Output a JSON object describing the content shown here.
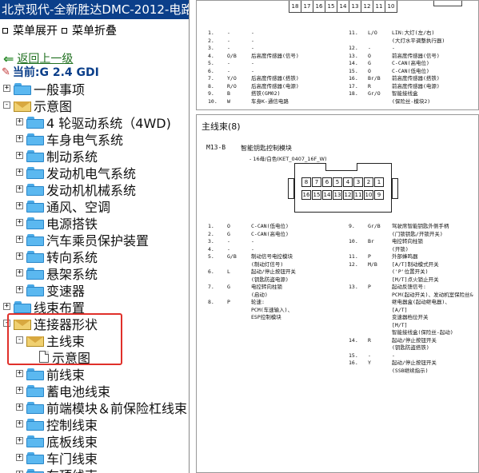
{
  "left_pane": {
    "title": "北京现代-全新胜达DMC-2012-电路图",
    "menu": {
      "expand": "菜单展开",
      "collapse": "菜单折叠"
    },
    "back": "返回上一级",
    "current": "当前:G 2.4 GDI",
    "tree": [
      {
        "label": "一般事项",
        "pm": "+",
        "icon": "folder"
      },
      {
        "label": "示意图",
        "pm": "-",
        "icon": "envelope"
      },
      {
        "label": "4 轮驱动系统（4WD)",
        "pm": "+",
        "icon": "folder"
      },
      {
        "label": "车身电气系统",
        "pm": "+",
        "icon": "folder"
      },
      {
        "label": "制动系统",
        "pm": "+",
        "icon": "folder"
      },
      {
        "label": "发动机电气系统",
        "pm": "+",
        "icon": "folder"
      },
      {
        "label": "发动机机械系统",
        "pm": "+",
        "icon": "folder"
      },
      {
        "label": "通风、空调",
        "pm": "+",
        "icon": "folder"
      },
      {
        "label": "电源搭铁",
        "pm": "+",
        "icon": "folder"
      },
      {
        "label": "汽车乘员保护装置",
        "pm": "+",
        "icon": "folder"
      },
      {
        "label": "转向系统",
        "pm": "+",
        "icon": "folder"
      },
      {
        "label": "悬架系统",
        "pm": "+",
        "icon": "folder"
      },
      {
        "label": "变速器",
        "pm": "+",
        "icon": "folder"
      },
      {
        "label": "线束布置",
        "pm": "+",
        "icon": "folder"
      },
      {
        "label": "连接器形状",
        "pm": "-",
        "icon": "envelope"
      },
      {
        "label": "主线束",
        "pm": "-",
        "icon": "envelope"
      },
      {
        "label": "示意图",
        "pm": "",
        "icon": "page"
      },
      {
        "label": "前线束",
        "pm": "+",
        "icon": "folder"
      },
      {
        "label": "蓄电池线束",
        "pm": "+",
        "icon": "folder"
      },
      {
        "label": "前端模块＆前保险杠线束",
        "pm": "+",
        "icon": "folder"
      },
      {
        "label": "控制线束",
        "pm": "+",
        "icon": "folder"
      },
      {
        "label": "底板线束",
        "pm": "+",
        "icon": "folder"
      },
      {
        "label": "车门线束",
        "pm": "+",
        "icon": "folder"
      },
      {
        "label": "车顶线束",
        "pm": "+",
        "icon": "folder"
      }
    ]
  },
  "top_panel": {
    "pin_strip": [
      "18",
      "17",
      "16",
      "15",
      "14",
      "13",
      "12",
      "11",
      "10"
    ],
    "left_pins": [
      {
        "n": "1.",
        "c": "-",
        "d": "-"
      },
      {
        "n": "2.",
        "c": "-",
        "d": "-"
      },
      {
        "n": "3.",
        "c": "-",
        "d": "-"
      },
      {
        "n": "4.",
        "c": "O/B",
        "d": "后高度传感器(信号)"
      },
      {
        "n": "5.",
        "c": "-",
        "d": "-"
      },
      {
        "n": "6.",
        "c": "-",
        "d": "-"
      },
      {
        "n": "7.",
        "c": "Y/O",
        "d": "后高度传感器(搭铁)"
      },
      {
        "n": "8.",
        "c": "R/O",
        "d": "后高度传感器(电源)"
      },
      {
        "n": "9.",
        "c": "B",
        "d": "搭铁(GM02)"
      },
      {
        "n": "10.",
        "c": "W",
        "d": "车身K-通信电路"
      }
    ],
    "right_pins": [
      {
        "n": "11.",
        "c": "L/O",
        "d": "LIN:大灯(左/右)"
      },
      {
        "n": "",
        "c": "",
        "d": "(大灯水平调整执行器)"
      },
      {
        "n": "12.",
        "c": "-",
        "d": "-"
      },
      {
        "n": "13.",
        "c": "O",
        "d": "前高度传感器(信号)"
      },
      {
        "n": "14.",
        "c": "G",
        "d": "C-CAN(高电位)"
      },
      {
        "n": "15.",
        "c": "O",
        "d": "C-CAN(低电位)"
      },
      {
        "n": "16.",
        "c": "Br/B",
        "d": "前高度传感器(搭铁)"
      },
      {
        "n": "17.",
        "c": "R",
        "d": "前高度传感器(电源)"
      },
      {
        "n": "18.",
        "c": "Gr/O",
        "d": "智能接线盒"
      },
      {
        "n": "",
        "c": "",
        "d": "(保险丝-模块2)"
      }
    ]
  },
  "bottom_panel": {
    "title": "主线束(8)",
    "conn_id": "M13-B",
    "conn_name": "智能钥匙控制模块",
    "conn_sub": "- 16母/白色(KET_0407_16F_W)",
    "row_top": [
      "8",
      "7",
      "6",
      "5",
      "4",
      "3",
      "2",
      "1"
    ],
    "row_bottom": [
      "16",
      "15",
      "14",
      "13",
      "12",
      "11",
      "10",
      "9"
    ],
    "left_pins": [
      {
        "n": "1.",
        "c": "O",
        "d": "C-CAN(低电位)"
      },
      {
        "n": "2.",
        "c": "G",
        "d": "C-CAN(高电位)"
      },
      {
        "n": "3.",
        "c": "-",
        "d": "-"
      },
      {
        "n": "4.",
        "c": "-",
        "d": "-"
      },
      {
        "n": "5.",
        "c": "G/B",
        "d": "制动信号电控模块"
      },
      {
        "n": "",
        "c": "",
        "d": "(制动灯信号)"
      },
      {
        "n": "6.",
        "c": "L",
        "d": "起动/停止按钮开关"
      },
      {
        "n": "",
        "c": "",
        "d": "(钥匙防盗电源)"
      },
      {
        "n": "7.",
        "c": "G",
        "d": "电控转向柱锁"
      },
      {
        "n": "",
        "c": "",
        "d": "(启动)"
      },
      {
        "n": "8.",
        "c": "P",
        "d": "轮速:"
      },
      {
        "n": "",
        "c": "",
        "d": "PCM(车速输入)、"
      },
      {
        "n": "",
        "c": "",
        "d": "ESP控制模块"
      }
    ],
    "right_pins": [
      {
        "n": "9.",
        "c": "Gr/B",
        "d": "驾驶席智能钥匙外侧手柄"
      },
      {
        "n": "",
        "c": "",
        "d": "(门锁钥匙/开锁开关)"
      },
      {
        "n": "10.",
        "c": "Br",
        "d": "电控转向柱锁"
      },
      {
        "n": "",
        "c": "",
        "d": "(开锁)"
      },
      {
        "n": "11.",
        "c": "P",
        "d": "外部蜂鸣器"
      },
      {
        "n": "12.",
        "c": "M/B",
        "d": "[A/T]制动模式开关"
      },
      {
        "n": "",
        "c": "",
        "d": "('P'位置开关)"
      },
      {
        "n": "",
        "c": "",
        "d": "[M/T]点火锁止开关"
      },
      {
        "n": "13.",
        "c": "P",
        "d": "起动反馈信号:"
      },
      {
        "n": "",
        "c": "",
        "d": "PCM(起动开关)、发动机室保险丝&"
      },
      {
        "n": "",
        "c": "",
        "d": "继电器盒(起动继电器)、"
      },
      {
        "n": "",
        "c": "",
        "d": "[A/T]"
      },
      {
        "n": "",
        "c": "",
        "d": "变速器档位开关"
      },
      {
        "n": "",
        "c": "",
        "d": "[M/T]"
      },
      {
        "n": "",
        "c": "",
        "d": "智能接线盒(保险丝-起动)"
      },
      {
        "n": "14.",
        "c": "R",
        "d": "起动/停止按钮开关"
      },
      {
        "n": "",
        "c": "",
        "d": "(钥匙防盗搭铁)"
      },
      {
        "n": "15.",
        "c": "-",
        "d": "-"
      },
      {
        "n": "16.",
        "c": "Y",
        "d": "起动/停止按钮开关"
      },
      {
        "n": "",
        "c": "",
        "d": "(SSB继续指示)"
      }
    ]
  }
}
